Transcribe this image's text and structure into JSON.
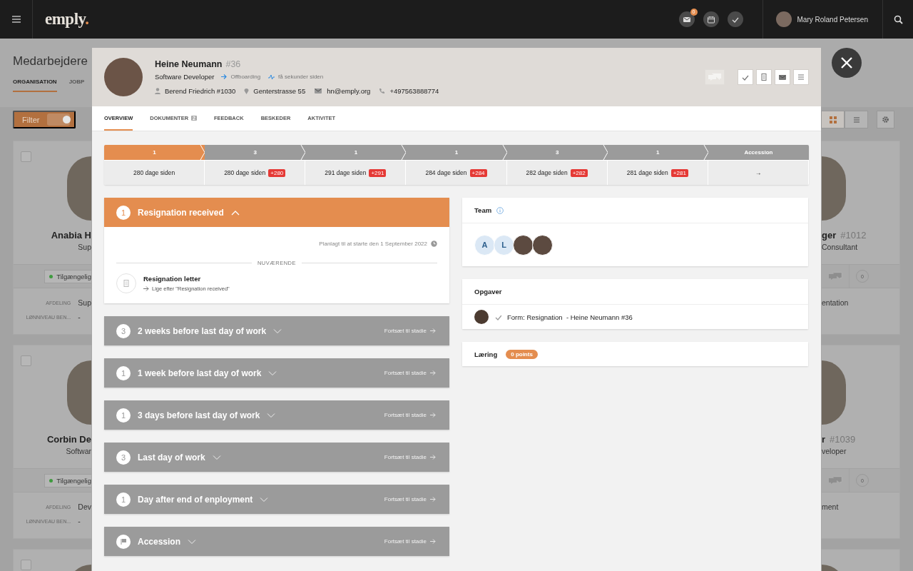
{
  "topbar": {
    "logo": "emply",
    "logo_mark": ".",
    "mail_badge": "0",
    "user": "Mary Roland Petersen"
  },
  "page": {
    "title": "Medarbejdere",
    "tabs": [
      {
        "label": "ORGANISATION",
        "selected": true
      },
      {
        "label": "JOBP",
        "selected": false
      }
    ],
    "filter": {
      "label": "Filter",
      "on": true
    },
    "views": [
      {
        "kind": "grid",
        "selected": true
      },
      {
        "kind": "list",
        "selected": false
      }
    ]
  },
  "left_cards": [
    {
      "checked": false,
      "photo": true,
      "name": "Anabia H",
      "title": "Sup",
      "status": "Tilgængelig",
      "fields": [
        {
          "label": "AFDELING",
          "value": "Sup"
        },
        {
          "label": "LØNNIVEAU BEN...",
          "value": "-"
        }
      ]
    },
    {
      "checked": false,
      "photo": true,
      "name": "Corbin De",
      "title": "Softwar",
      "status": "Tilgængelig",
      "fields": [
        {
          "label": "AFDELING",
          "value": "Dev"
        },
        {
          "label": "LØNNIVEAU BEN...",
          "value": "-"
        }
      ]
    },
    {
      "checked": false,
      "photo": true
    }
  ],
  "right_cards": [
    {
      "photo": true,
      "name": "ger",
      "number": "#1012",
      "title": "Consultant",
      "count": "0",
      "field_value": "entation"
    },
    {
      "photo": true,
      "name": "r",
      "number": "#1039",
      "title": "veloper",
      "count": "0",
      "field_value": "ment"
    },
    {
      "photo": true
    }
  ],
  "modal": {
    "name": "Heine Neumann",
    "number": "#36",
    "role": "Software Developer",
    "process": "Offboarding",
    "updated": "få sekunder siden",
    "manager": "Berend Friedrich #1030",
    "address": "Genterstrasse 55",
    "email": "hn@emply.org",
    "phone": "+497563888774",
    "actions": [
      {
        "kind": "chat",
        "disabled": true
      },
      {
        "kind": "check",
        "disabled": false
      },
      {
        "kind": "document",
        "disabled": false
      },
      {
        "kind": "mail",
        "disabled": false
      },
      {
        "kind": "menu",
        "disabled": false
      }
    ],
    "tabs": [
      {
        "label": "OVERVIEW",
        "selected": true
      },
      {
        "label": "DOKUMENTER",
        "badge": "2",
        "selected": false
      },
      {
        "label": "FEEDBACK",
        "selected": false
      },
      {
        "label": "BESKEDER",
        "selected": false
      },
      {
        "label": "AKTIVITET",
        "selected": false
      }
    ],
    "stage_bar": [
      {
        "label": "1",
        "detail": "280 dage siden",
        "selected": true
      },
      {
        "label": "3",
        "detail": "280 dage siden",
        "badge": "+280",
        "selected": false
      },
      {
        "label": "1",
        "detail": "291 dage siden",
        "badge": "+291",
        "selected": false
      },
      {
        "label": "1",
        "detail": "284 dage siden",
        "badge": "+284",
        "selected": false
      },
      {
        "label": "3",
        "detail": "282 dage siden",
        "badge": "+282",
        "selected": false
      },
      {
        "label": "1",
        "detail": "281 dage siden",
        "badge": "+281",
        "selected": false
      },
      {
        "label": "Accession",
        "detail": "→",
        "selected": false
      }
    ],
    "stages": [
      {
        "kind": "number",
        "count": "1",
        "title": "Resignation received",
        "expanded": true,
        "schedule": "Planlagt til at starte den 1 September 2022",
        "section": "NUVÆRENDE",
        "items": [
          {
            "title": "Resignation letter",
            "note": "Lige efter \"Resignation received\""
          }
        ]
      },
      {
        "kind": "number",
        "count": "3",
        "title": "2 weeks before last day of work",
        "expanded": false,
        "action": "Fortsæt til stadie"
      },
      {
        "kind": "number",
        "count": "1",
        "title": "1 week before last day of work",
        "expanded": false,
        "action": "Fortsæt til stadie"
      },
      {
        "kind": "number",
        "count": "1",
        "title": "3 days before last day of work",
        "expanded": false,
        "action": "Fortsæt til stadie"
      },
      {
        "kind": "number",
        "count": "3",
        "title": "Last day of work",
        "expanded": false,
        "action": "Fortsæt til stadie"
      },
      {
        "kind": "number",
        "count": "1",
        "title": "Day after end of enployment",
        "expanded": false,
        "action": "Fortsæt til stadie"
      },
      {
        "kind": "flag",
        "title": "Accession",
        "expanded": false,
        "action": "Fortsæt til stadie"
      }
    ],
    "team": {
      "title": "Team",
      "members": [
        {
          "kind": "initial",
          "text": "A"
        },
        {
          "kind": "initial",
          "text": "L"
        },
        {
          "kind": "photo"
        },
        {
          "kind": "photo"
        }
      ]
    },
    "tasks": {
      "title": "Opgaver",
      "items": [
        {
          "text": "Form: Resignation  - Heine Neumann #36",
          "done": true
        }
      ]
    },
    "learning": {
      "title": "Læring",
      "points": "0 points"
    }
  }
}
